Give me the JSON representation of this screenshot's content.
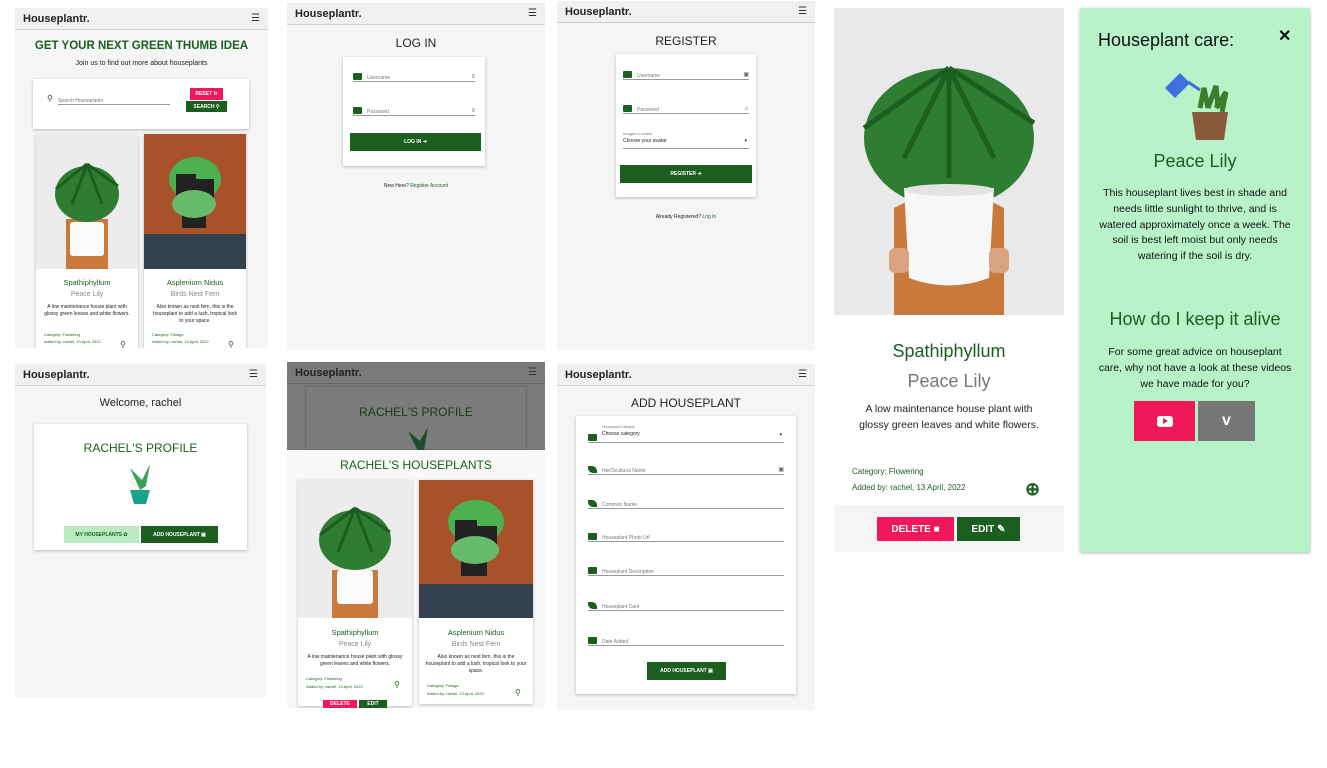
{
  "brand": "Houseplantr.",
  "colors": {
    "dark_green": "#1b5e20",
    "pink": "#f0185a",
    "mint": "#b8f2c8",
    "light_green_btn": "#b9eac0",
    "grey": "#777777"
  },
  "home": {
    "headline": "GET YOUR NEXT GREEN THUMB IDEA",
    "subline": "Join us to find out more about houseplants",
    "search_placeholder": "Search Houseplants",
    "reset_label": "RESET",
    "search_label": "SEARCH",
    "cards": [
      {
        "name": "Spathiphyllum",
        "common": "Peace Lily",
        "desc": "A low maintenance house plant with glossy green leaves and white flowers.",
        "category": "Category: Flowering",
        "added": "Added by: rachel, 13 April, 2022"
      },
      {
        "name": "Asplenium Nidus",
        "common": "Birds Nest Fern",
        "desc": "Also known as nest fern, this is the houseplant to add a lush, tropical look to your space.",
        "category": "Category: Foliage",
        "added": "Added by: rachel, 13 April, 2022"
      }
    ]
  },
  "login": {
    "title": "LOG IN",
    "username": "Username",
    "password": "Password",
    "button": "LOG IN",
    "new_here": "New Here?",
    "register_link": "Register Account"
  },
  "register": {
    "title": "REGISTER",
    "username": "Username",
    "password": "Password",
    "images_label": "Images to select",
    "select_value": "Choose your avatar",
    "button": "REGISTER",
    "already": "Already Registered?",
    "login_link": "Log In"
  },
  "detail": {
    "name": "Spathiphyllum",
    "common": "Peace Lily",
    "desc": "A low maintenance house plant with glossy green leaves and white flowers.",
    "category": "Category: Flowering",
    "added": "Added by: rachel, 13 April, 2022",
    "delete_label": "DELETE",
    "edit_label": "EDIT"
  },
  "care": {
    "title": "Houseplant care:",
    "plant_name": "Peace Lily",
    "text": "This houseplant lives best in shade and needs little sunlight to thrive, and is watered approximately once a week. The soil is best left moist but only needs watering if the soil is dry.",
    "keep_alive": "How do I keep it alive",
    "advice": "For some great advice on houseplant care, why not have a look at these videos we have made for you?",
    "close": "✕"
  },
  "profile": {
    "welcome": "Welcome, rachel",
    "title": "RACHEL'S PROFILE",
    "my_plants": "MY HOUSEPLANTS",
    "add_plant": "ADD HOUSEPLANT"
  },
  "profile2": {
    "title": "RACHEL'S PROFILE",
    "houseplants_title": "RACHEL'S HOUSEPLANTS",
    "delete_label": "DELETE",
    "edit_label": "EDIT"
  },
  "add": {
    "title": "ADD HOUSEPLANT",
    "category_label": "Houseplant Category",
    "category_value": "Choose category",
    "fields": [
      "Her/Scultural Name",
      "Common Name",
      "Houseplant Photo Url",
      "Houseplant Description",
      "Houseplant Care",
      "Date Added"
    ],
    "button": "ADD HOUSEPLANT"
  }
}
